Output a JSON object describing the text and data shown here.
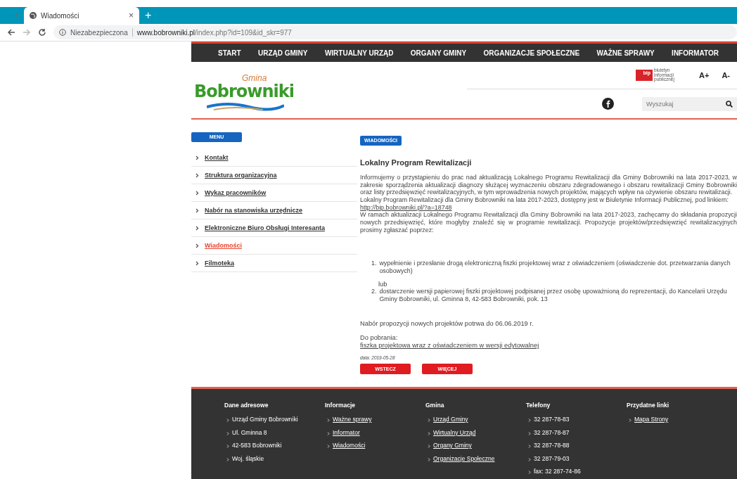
{
  "browser": {
    "tab": {
      "title": "Wiadomości",
      "close": "×"
    },
    "new_tab": "+",
    "security": "Niezabezpieczona",
    "url_domain": "www.bobrowniki.pl",
    "url_path": "/index.php?id=109&id_skr=977"
  },
  "nav": [
    {
      "label": "START"
    },
    {
      "label": "URZĄD GMINY"
    },
    {
      "label": "WIRTUALNY URZĄD"
    },
    {
      "label": "ORGANY GMINY"
    },
    {
      "label": "ORGANIZACJE SPOŁECZNE"
    },
    {
      "label": "WAŻNE SPRAWY"
    },
    {
      "label": "INFORMATOR"
    }
  ],
  "logo": {
    "small": "Gmina",
    "big": "Bobrowniki"
  },
  "bip": {
    "mark": "bip",
    "text": "biuletyn informacji publicznej"
  },
  "font_buttons": [
    "A+",
    "A-"
  ],
  "search": {
    "placeholder": "Wyszukaj"
  },
  "sidebar": {
    "title": "MENU",
    "items": [
      {
        "label": "Kontakt",
        "selected": false
      },
      {
        "label": "Struktura organizacyjna",
        "selected": false
      },
      {
        "label": "Wykaz pracowników",
        "selected": false
      },
      {
        "label": "Nabór na stanowiska urzędnicze",
        "selected": false
      },
      {
        "label": "Elektroniczne Biuro Obsługi Interesanta",
        "selected": false
      },
      {
        "label": "Wiadomości",
        "selected": true
      },
      {
        "label": "Filmoteka",
        "selected": false
      }
    ]
  },
  "article": {
    "section": "WIADOMOŚCI",
    "title": "Lokalny Program Rewitalizacji",
    "paragraphs": [
      "Informujemy o przystąpieniu do prac nad aktualizacją Lokalnego Programu Rewitalizacji dla Gminy Bobrowniki na lata 2017-2023, w zakresie sporządzenia aktualizacji diagnozy służącej wyznaczeniu obszaru zdegradowanego i obszaru rewitalizacji Gminy Bobrowniki oraz listy przedsięwzięć rewitalizacyjnych, w tym wprowadzenia nowych projektów, mających wpływ na ożywienie obszaru rewitalizacji.",
      "Lokalny Program Rewitalizacji dla Gminy Bobrowniki na lata 2017-2023, dostępny jest w Biuletynie Informacji Publicznej, pod linkiem:"
    ],
    "link": "http://bip.bobrowniki.pl/?a=18748",
    "paragraph_after": "W ramach aktualizacji Lokalnego Programu Rewitalizacji dla Gminy Bobrowniki na lata 2017-2023, zachęcamy do składania propozycji nowych przedsięwzięć, które mogłyby znaleźć się w programie rewitalizacji. Propozycje projektów/przedsięwzięć rewitalizacyjnych prosimy zgłaszać poprzez:",
    "list": [
      {
        "number": "1.",
        "text": "wypełnienie i przesłanie drogą elektroniczną fiszki projektowej wraz z oświadczeniem (oświadczenie dot. przetwarzania danych osobowych)",
        "after": "lub"
      },
      {
        "number": "2.",
        "text": "dostarczenie wersji papierowej fiszki projektowej podpisanej przez osobę upoważnioną do reprezentacji, do Kancelarii Urzędu Gminy Bobrowniki, ul. Gminna 8, 42-583 Bobrowniki, pok. 13"
      }
    ],
    "deadline": "Nabór propozycji nowych projektów potrwa do 06.06.2019 r.",
    "download_label": "Do pobrania:",
    "download_link": "fiszka projektowa wraz z oświadczeniem w wersji edytowalnej",
    "date": "data: 2019-05-28",
    "buttons": [
      "WSTECZ",
      "WIĘCEJ"
    ]
  },
  "footer": [
    {
      "heading": "Dane adresowe",
      "items": [
        {
          "kind": "text",
          "label": "Urząd Gminy Bobrowniki"
        },
        {
          "kind": "text",
          "label": "Ul. Gminna 8"
        },
        {
          "kind": "text",
          "label": "42-583 Bobrowniki"
        },
        {
          "kind": "text",
          "label": "Woj. śląskie"
        }
      ]
    },
    {
      "heading": "Informacje",
      "items": [
        {
          "kind": "link",
          "label": "Ważne sprawy"
        },
        {
          "kind": "link",
          "label": "Informator"
        },
        {
          "kind": "link",
          "label": "Wiadomości"
        }
      ]
    },
    {
      "heading": "Gmina",
      "items": [
        {
          "kind": "link",
          "label": "Urząd Gminy"
        },
        {
          "kind": "link",
          "label": "Wirtualny Urząd"
        },
        {
          "kind": "link",
          "label": "Organy Gminy"
        },
        {
          "kind": "link",
          "label": "Organizacje Społeczne"
        }
      ]
    },
    {
      "heading": "Telefony",
      "items": [
        {
          "kind": "text",
          "label": "32 287-78-83"
        },
        {
          "kind": "text",
          "label": "32 287-78-87"
        },
        {
          "kind": "text",
          "label": "32 287-78-88"
        },
        {
          "kind": "text",
          "label": "32 287-79-03"
        },
        {
          "kind": "text",
          "label": "fax: 32 287-74-86"
        }
      ]
    },
    {
      "heading": "Przydatne linki",
      "items": [
        {
          "kind": "link",
          "label": "Mapa Strony"
        }
      ]
    }
  ]
}
